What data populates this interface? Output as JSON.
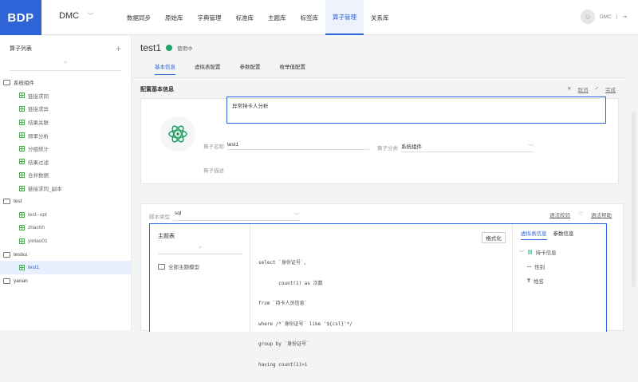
{
  "brand": "BDP",
  "workspace": "DMC",
  "nav": [
    "数据同步",
    "原始库",
    "字典管理",
    "标准库",
    "主题库",
    "标签库",
    "算子管理",
    "关系库"
  ],
  "user": "DMC",
  "sidebar": {
    "title": "算子列表",
    "items": [
      {
        "label": "系统组件",
        "kind": "folder"
      },
      {
        "label": "链接求同",
        "kind": "leaf"
      },
      {
        "label": "链接求异",
        "kind": "leaf"
      },
      {
        "label": "结果关联",
        "kind": "leaf"
      },
      {
        "label": "频率分析",
        "kind": "leaf"
      },
      {
        "label": "分组统计",
        "kind": "leaf"
      },
      {
        "label": "结果过滤",
        "kind": "leaf"
      },
      {
        "label": "合并数据",
        "kind": "leaf"
      },
      {
        "label": "链接求同_副本",
        "kind": "leaf"
      },
      {
        "label": "test",
        "kind": "folder"
      },
      {
        "label": "test--opt",
        "kind": "leaf"
      },
      {
        "label": "zhachh",
        "kind": "leaf"
      },
      {
        "label": "yintao01",
        "kind": "leaf"
      },
      {
        "label": "testxu",
        "kind": "folder"
      },
      {
        "label": "test1",
        "kind": "leaf",
        "selected": true
      },
      {
        "label": "yanan",
        "kind": "folder"
      }
    ]
  },
  "page": {
    "title": "test1",
    "status": "使用中",
    "tabs": [
      "基本信息",
      "虚拟表配置",
      "参数配置",
      "枚举值配置"
    ]
  },
  "section": {
    "title": "配置基本信息",
    "cancel": "取消",
    "done": "完成"
  },
  "form": {
    "name_label": "算子名称",
    "name_value": "test1",
    "category_label": "算子分类",
    "category_value": "系统组件",
    "desc_label": "算子描述",
    "desc_value": "异常持卡人分析"
  },
  "script": {
    "type_label": "脚本类型",
    "type_value": "sql",
    "validate": "语法校验",
    "help": "语法帮助",
    "left_header": "主题表",
    "left_item": "全部主题模型",
    "format_btn": "格式化",
    "code": [
      "select `身份证号`,",
      "       count(1) as 次数",
      "from `持卡人员信息`",
      "where /*`身份证号` like '${csl}'*/",
      "group by `身份证号`",
      "having count(1)>1"
    ],
    "right_tabs": [
      "虚拟表信息",
      "参数信息"
    ],
    "right_items": [
      "持卡信息",
      "性别",
      "姓名"
    ]
  },
  "colors": {
    "accent": "#2f63d8",
    "status": "#21a366"
  }
}
